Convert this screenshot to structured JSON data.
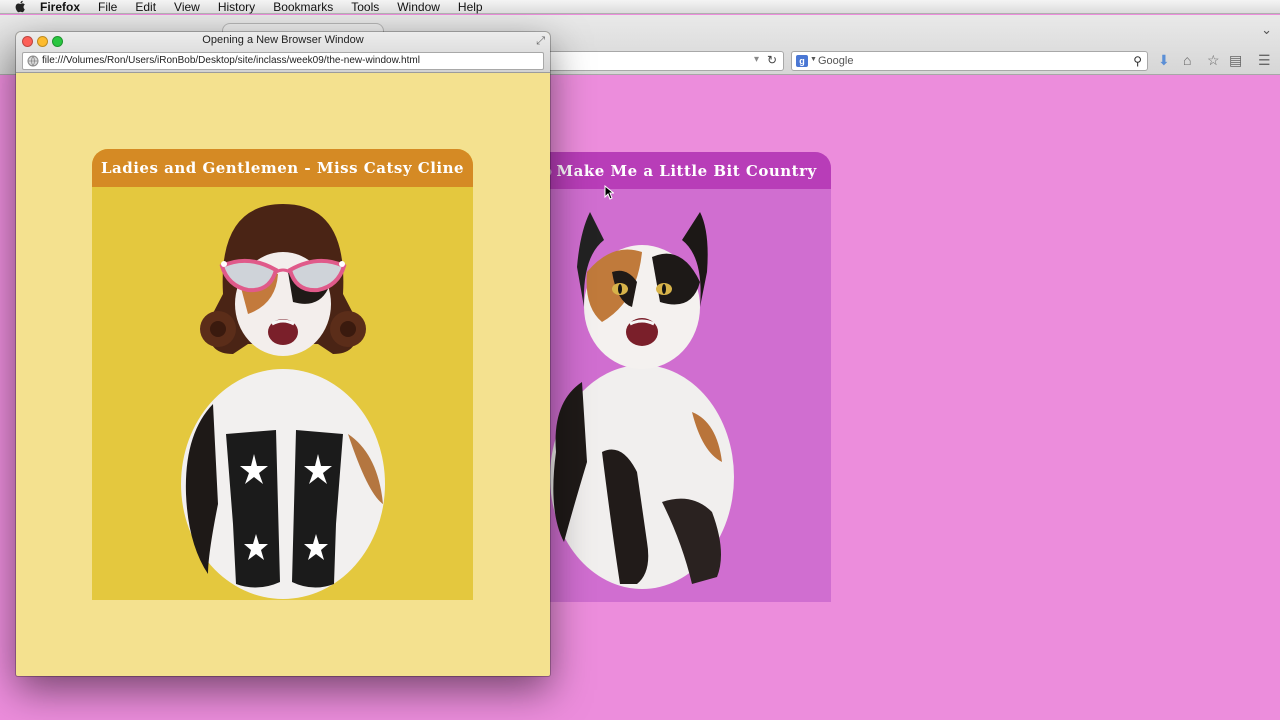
{
  "menubar": {
    "app_name": "Firefox",
    "items": [
      "File",
      "Edit",
      "View",
      "History",
      "Bookmarks",
      "Tools",
      "Window",
      "Help"
    ]
  },
  "main_window": {
    "search": {
      "engine": "Google",
      "placeholder": "Google"
    },
    "card": {
      "title": "Make Me a Little Bit Country",
      "image": "calico-cat-image"
    },
    "background_color": "#ec8ddc"
  },
  "popup_window": {
    "title": "Opening a New Browser Window",
    "url": "file:///Volumes/Ron/Users/iRonBob/Desktop/site/inclass/week09/the-new-window.html",
    "background_color": "#f4e18f",
    "card": {
      "title": "Ladies and Gentlemen - Miss Catsy Cline",
      "image": "calico-cat-with-wig-glasses-boots-image",
      "header_color": "#d58a24",
      "body_color": "#e4c83e"
    }
  }
}
